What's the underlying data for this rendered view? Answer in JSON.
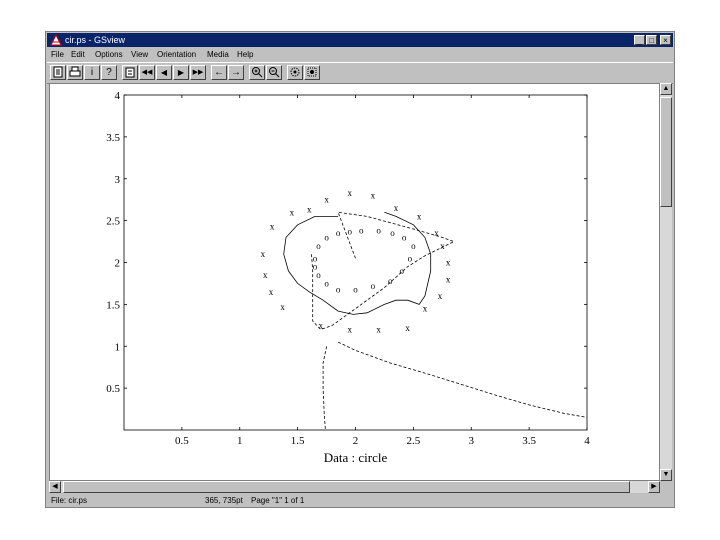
{
  "window": {
    "title": "cir.ps - GSview"
  },
  "title_buttons": {
    "minimize": "_",
    "maximize": "□",
    "close": "×"
  },
  "menu": [
    "File",
    "Edit",
    "Options",
    "View",
    "Orientation",
    "Media",
    "Help"
  ],
  "toolbar": [
    {
      "icon": "page-icon"
    },
    {
      "icon": "printer-icon"
    },
    {
      "label": "i",
      "icon": "info-icon"
    },
    {
      "label": "?",
      "icon": "help-icon"
    },
    {
      "icon": "goto-page-icon"
    },
    {
      "label": "◀◀",
      "icon": "rewind-icon"
    },
    {
      "label": "◀",
      "icon": "prev-page-icon"
    },
    {
      "label": "▶",
      "icon": "next-page-icon"
    },
    {
      "label": "▶▶",
      "icon": "fast-forward-icon"
    },
    {
      "label": "←",
      "icon": "back-icon"
    },
    {
      "label": "→",
      "icon": "forward-icon"
    },
    {
      "icon": "zoom-in-icon"
    },
    {
      "icon": "zoom-out-icon"
    },
    {
      "icon": "magnify-icon"
    },
    {
      "icon": "magnify-dotted-icon"
    }
  ],
  "status": {
    "file": "File: cir.ps",
    "coords": "365, 735pt",
    "page": "Page \"1\" 1 of 1"
  },
  "colors": {
    "titlebar": "#0a246a",
    "chrome": "#c0c0c0"
  },
  "chart_data": {
    "type": "scatter",
    "xlabel": "Data : circle",
    "xticks": [
      "0.5",
      "1",
      "1.5",
      "2",
      "2.5",
      "3",
      "3.5",
      "4"
    ],
    "yticks": [
      "0.5",
      "1",
      "1.5",
      "2",
      "2.5",
      "3",
      "3.5",
      "4"
    ],
    "xlim": [
      0,
      4
    ],
    "ylim": [
      0,
      4
    ],
    "series": [
      {
        "marker": "o",
        "points": [
          [
            1.65,
            2.05
          ],
          [
            1.68,
            2.2
          ],
          [
            1.75,
            2.3
          ],
          [
            1.85,
            2.35
          ],
          [
            1.95,
            2.37
          ],
          [
            2.05,
            2.38
          ],
          [
            2.2,
            2.38
          ],
          [
            2.32,
            2.35
          ],
          [
            2.42,
            2.3
          ],
          [
            2.5,
            2.2
          ],
          [
            2.47,
            2.05
          ],
          [
            2.4,
            1.9
          ],
          [
            2.3,
            1.78
          ],
          [
            2.15,
            1.72
          ],
          [
            2.0,
            1.68
          ],
          [
            1.85,
            1.68
          ],
          [
            1.75,
            1.75
          ],
          [
            1.68,
            1.85
          ],
          [
            1.65,
            1.95
          ]
        ]
      },
      {
        "marker": "x",
        "points": [
          [
            1.95,
            2.83
          ],
          [
            2.15,
            2.8
          ],
          [
            1.75,
            2.75
          ],
          [
            2.35,
            2.65
          ],
          [
            1.6,
            2.63
          ],
          [
            1.45,
            2.6
          ],
          [
            2.55,
            2.55
          ],
          [
            1.28,
            2.43
          ],
          [
            2.7,
            2.35
          ],
          [
            2.75,
            2.2
          ],
          [
            1.2,
            2.1
          ],
          [
            2.8,
            2.0
          ],
          [
            2.8,
            1.8
          ],
          [
            1.22,
            1.85
          ],
          [
            1.27,
            1.65
          ],
          [
            2.73,
            1.6
          ],
          [
            2.6,
            1.45
          ],
          [
            1.37,
            1.47
          ],
          [
            2.45,
            1.22
          ],
          [
            2.2,
            1.2
          ],
          [
            1.95,
            1.2
          ],
          [
            1.7,
            1.25
          ]
        ]
      },
      {
        "line": "solid",
        "points": [
          [
            1.85,
            2.55
          ],
          [
            1.65,
            2.55
          ],
          [
            1.5,
            2.45
          ],
          [
            1.4,
            2.3
          ],
          [
            1.38,
            2.1
          ],
          [
            1.42,
            1.9
          ],
          [
            1.5,
            1.75
          ],
          [
            1.6,
            1.65
          ],
          [
            1.72,
            1.55
          ],
          [
            1.85,
            1.42
          ],
          [
            1.98,
            1.38
          ],
          [
            2.1,
            1.4
          ],
          [
            2.25,
            1.5
          ],
          [
            2.35,
            1.55
          ],
          [
            2.45,
            1.55
          ],
          [
            2.55,
            1.5
          ],
          [
            2.6,
            1.6
          ],
          [
            2.65,
            1.9
          ],
          [
            2.65,
            2.1
          ],
          [
            2.6,
            2.3
          ],
          [
            2.5,
            2.45
          ],
          [
            2.35,
            2.55
          ],
          [
            2.25,
            2.6
          ]
        ]
      },
      {
        "line": "dashed",
        "points": [
          [
            2.0,
            2.05
          ],
          [
            1.85,
            2.6
          ],
          [
            2.1,
            2.55
          ],
          [
            2.5,
            2.4
          ],
          [
            2.75,
            2.3
          ],
          [
            2.85,
            2.25
          ],
          [
            2.6,
            2.08
          ],
          [
            2.45,
            1.95
          ],
          [
            2.25,
            1.7
          ],
          [
            2.0,
            1.45
          ],
          [
            1.8,
            1.25
          ],
          [
            1.7,
            1.2
          ],
          [
            1.63,
            1.3
          ],
          [
            1.63,
            1.6
          ],
          [
            1.63,
            1.9
          ],
          [
            1.62,
            2.1
          ]
        ]
      },
      {
        "line": "dashed",
        "points": [
          [
            1.75,
            1.0
          ],
          [
            1.72,
            0.8
          ],
          [
            1.72,
            0.5
          ],
          [
            1.73,
            0.2
          ],
          [
            1.74,
            0.0
          ]
        ]
      },
      {
        "line": "dashed",
        "points": [
          [
            1.85,
            1.05
          ],
          [
            2.0,
            0.95
          ],
          [
            2.3,
            0.8
          ],
          [
            2.6,
            0.68
          ],
          [
            2.9,
            0.55
          ],
          [
            3.2,
            0.42
          ],
          [
            3.5,
            0.3
          ],
          [
            3.8,
            0.2
          ],
          [
            4.0,
            0.15
          ]
        ]
      }
    ]
  }
}
